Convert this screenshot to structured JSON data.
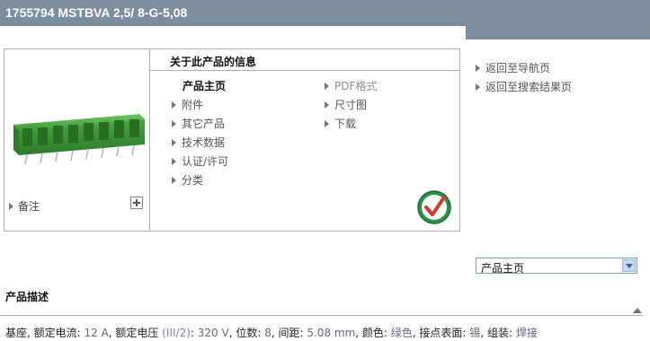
{
  "header": {
    "title": "1755794 MSTBVA 2,5/ 8-G-5,08"
  },
  "product": {
    "note_label": "备注",
    "expand_icon": "plus-icon",
    "image_icon": "terminal-block-connector",
    "badge_icon": "rohs-compliant-badge"
  },
  "info": {
    "title": "关于此产品的信息",
    "left_links": [
      {
        "label": "产品主页",
        "active": true
      },
      {
        "label": "附件"
      },
      {
        "label": "其它产品"
      },
      {
        "label": "技术数据"
      },
      {
        "label": "认证/许可"
      },
      {
        "label": "分类"
      }
    ],
    "right_links": [
      {
        "label": "PDF格式"
      },
      {
        "label": "尺寸图"
      },
      {
        "label": "下载"
      }
    ]
  },
  "nav": {
    "back_to_nav": "返回至导航页",
    "back_to_results": "返回至搜索结果页"
  },
  "select": {
    "value": "产品主页"
  },
  "description": {
    "title": "产品描述",
    "parts": [
      "基座, 额定电流: ",
      "12 A",
      ", 额定电压 ",
      "(III/2)",
      ": ",
      "320 V",
      ", 位数: ",
      "8",
      ", 间距: ",
      "5.08 mm",
      ", 颜色: ",
      "绿色",
      ", 接点表面: ",
      "锡",
      ", 组装: ",
      "焊接"
    ]
  },
  "colors": {
    "title_bar": "#7d8da0",
    "connector_green": "#3f9a3a",
    "accent_red": "#d23b2a"
  }
}
